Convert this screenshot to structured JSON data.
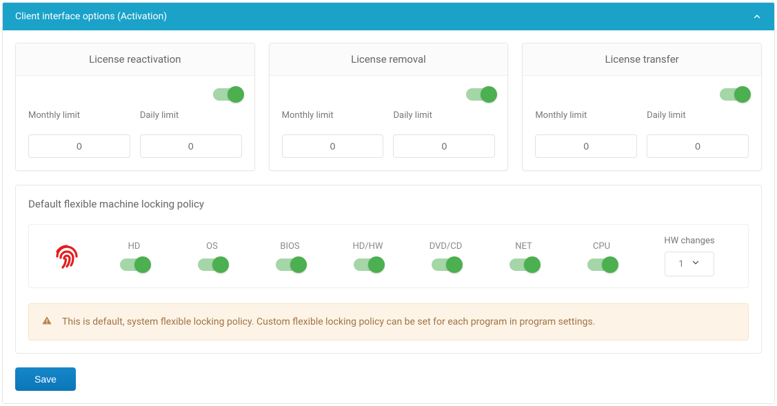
{
  "panel": {
    "title": "Client interface options (Activation)"
  },
  "cards": {
    "reactivation": {
      "title": "License reactivation",
      "monthly_label": "Monthly limit",
      "daily_label": "Daily limit",
      "monthly_value": "0",
      "daily_value": "0"
    },
    "removal": {
      "title": "License removal",
      "monthly_label": "Monthly limit",
      "daily_label": "Daily limit",
      "monthly_value": "0",
      "daily_value": "0"
    },
    "transfer": {
      "title": "License transfer",
      "monthly_label": "Monthly limit",
      "daily_label": "Daily limit",
      "monthly_value": "0",
      "daily_value": "0"
    }
  },
  "policy": {
    "title": "Default flexible machine locking policy",
    "items": {
      "hd": "HD",
      "os": "OS",
      "bios": "BIOS",
      "hdhw": "HD/HW",
      "dvdcd": "DVD/CD",
      "net": "NET",
      "cpu": "CPU"
    },
    "hw_changes_label": "HW changes",
    "hw_changes_value": "1",
    "notice": "This is default, system flexible locking policy. Custom flexible locking policy can be set for each program in program settings."
  },
  "buttons": {
    "save": "Save"
  }
}
